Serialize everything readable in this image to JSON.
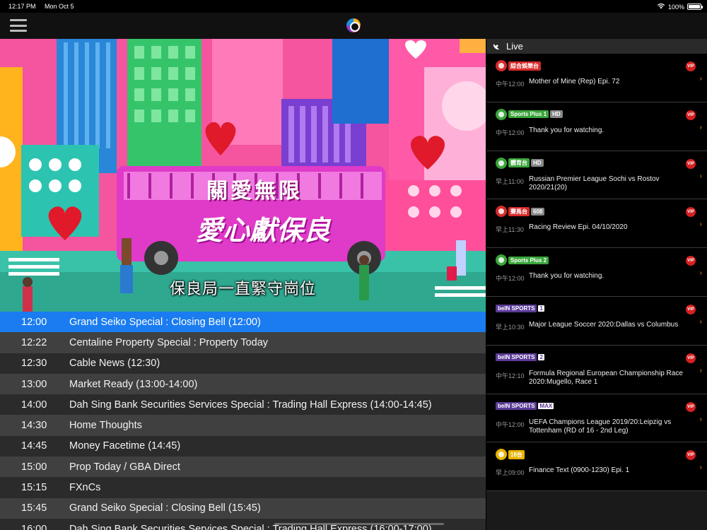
{
  "status_bar": {
    "time": "12:17 PM",
    "date": "Mon Oct 5",
    "battery": "100%"
  },
  "icons": {
    "menu": "hamburger-menu-icon",
    "logo": "app-logo-icon",
    "live": "satellite-dish-icon",
    "vip": "vip-badge-icon",
    "chevron": "chevron-right-icon"
  },
  "video": {
    "bus_sign": "關愛無限",
    "bus_banner": "愛心獻保良",
    "subtitle": "保良局一直緊守崗位"
  },
  "schedule": [
    {
      "time": "12:00",
      "title": "Grand Seiko Special : Closing Bell (12:00)",
      "current": true
    },
    {
      "time": "12:22",
      "title": "Centaline Property Special : Property Today"
    },
    {
      "time": "12:30",
      "title": "Cable News (12:30)"
    },
    {
      "time": "13:00",
      "title": "Market Ready (13:00-14:00)"
    },
    {
      "time": "14:00",
      "title": "Dah Sing Bank Securities Services Special : Trading Hall Express (14:00-14:45)"
    },
    {
      "time": "14:30",
      "title": "Home Thoughts"
    },
    {
      "time": "14:45",
      "title": "Money Facetime (14:45)"
    },
    {
      "time": "15:00",
      "title": "Prop Today / GBA Direct"
    },
    {
      "time": "15:15",
      "title": "FXnCs"
    },
    {
      "time": "15:45",
      "title": "Grand Seiko Special : Closing Bell (15:45)"
    },
    {
      "time": "16:00",
      "title": "Dah Sing Bank Securities Services Special : Trading Hall Express (16:00-17:00)"
    }
  ],
  "live": {
    "header": "Live",
    "vip_label": "VIP",
    "channels": [
      {
        "logo_text": "綜合娛樂台",
        "logo_badge": "",
        "time": "中午12:00",
        "program": "Mother of Mine (Rep) Epi. 72",
        "swirl_color": "#d82a2a"
      },
      {
        "logo_text": "Sports Plus 1",
        "logo_badge": "HD",
        "time": "中午12:00",
        "program": "Thank you for watching.",
        "swirl_color": "#3aa53a"
      },
      {
        "logo_text": "體育台",
        "logo_badge": "HD",
        "time": "早上11:00",
        "program": "Russian Premier League Sochi vs Rostov 2020/21(20)",
        "swirl_color": "#3aa53a"
      },
      {
        "logo_text": "賽馬台",
        "logo_badge": "608",
        "time": "早上11:30",
        "program": "Racing Review Epi. 04/10/2020",
        "swirl_color": "#d82a2a"
      },
      {
        "logo_text": "Sports Plus 2",
        "logo_badge": "",
        "time": "中午12:00",
        "program": "Thank you for watching.",
        "swirl_color": "#3aa53a"
      },
      {
        "logo_text": "beIN SPORTS",
        "logo_badge": "1",
        "time": "早上10:30",
        "program": "Major League Soccer 2020:Dallas vs Columbus",
        "bein": true
      },
      {
        "logo_text": "beIN SPORTS",
        "logo_badge": "2",
        "time": "中午12:10",
        "program": "Formula Regional European Championship Race 2020:Mugello, Race 1",
        "bein": true
      },
      {
        "logo_text": "beIN SPORTS",
        "logo_badge": "MAX",
        "time": "中午12:00",
        "program": "UEFA Champions League 2019/20:Leipzig vs Tottenham  (RD of 16 - 2nd Leg)",
        "bein": true
      },
      {
        "logo_text": "18台",
        "logo_badge": "",
        "time": "早上09:00",
        "program": "Finance Text (0900-1230) Epi. 1",
        "swirl_color": "#e8b400"
      }
    ]
  }
}
